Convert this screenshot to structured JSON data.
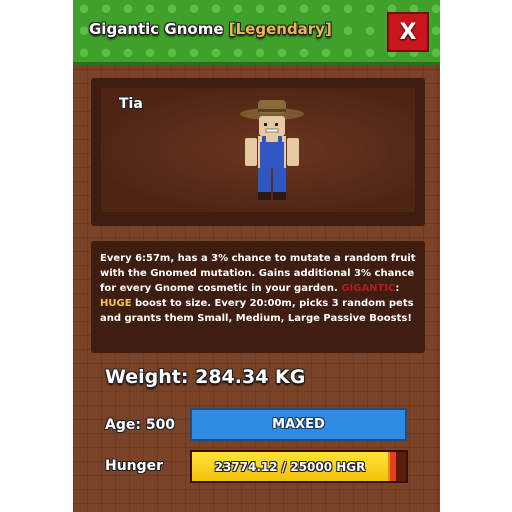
{
  "header": {
    "title": "Gigantic Gnome",
    "rarity": "[Legendary]",
    "close_label": "X"
  },
  "pet": {
    "name": "Tia"
  },
  "description": {
    "part1": "Every 6:57m, has a 3% chance to mutate a random fruit with the Gnomed mutation. Gains additional 3% chance for every Gnome cosmetic in your garden. ",
    "gigantic_label": "GIGANTIC",
    "part2": ": ",
    "huge_label": "HUGE",
    "part3": " boost to size. Every 20:00m, picks 3 random pets and grants them Small, Medium, Large Passive Boosts!"
  },
  "stats": {
    "weight_text": "Weight: 284.34 KG",
    "age_text": "Age: 500",
    "age_bar_label": "MAXED",
    "hunger_label": "Hunger",
    "hunger_text": "23774.12 / 25000 HGR",
    "hunger_fraction": 0.951
  },
  "colors": {
    "header_green": "#3fa02c",
    "panel_brown": "#7a4328",
    "close_red": "#c8161c",
    "rarity_gold": "#e9b949",
    "age_blue": "#2f8be2",
    "hunger_yellow": "#f4c10a"
  }
}
